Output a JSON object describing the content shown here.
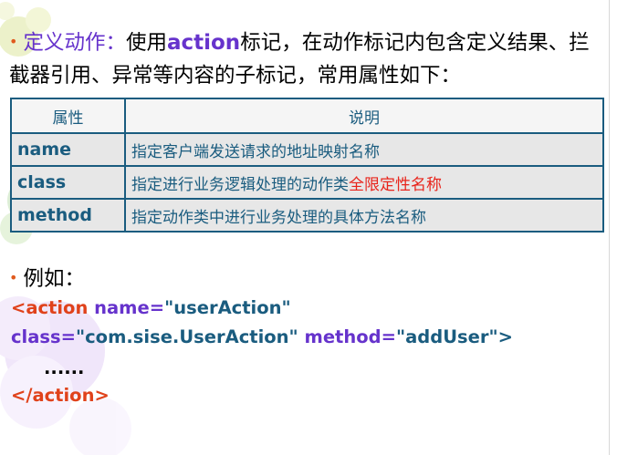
{
  "intro": {
    "bullet": "•",
    "label": "定义动作：",
    "text_before": "使用",
    "keyword": "action",
    "text_after": "标记，在动作标记内包含定义结果、拦截器引用、异常等内容的子标记，常用属性如下："
  },
  "table": {
    "headers": [
      "属性",
      "说明"
    ],
    "rows": [
      {
        "attr": "name",
        "desc": "指定客户端发送请求的地址映射名称",
        "desc_highlight": ""
      },
      {
        "attr": "class",
        "desc": "指定进行业务逻辑处理的动作类",
        "desc_highlight": "全限定性名称"
      },
      {
        "attr": "method",
        "desc": "指定动作类中进行业务处理的具体方法名称",
        "desc_highlight": ""
      }
    ]
  },
  "example": {
    "bullet": "•",
    "label": "例如："
  },
  "code": {
    "line1_tag": "<action",
    "line1_attr": "name=",
    "line1_value": "\"userAction\"",
    "line2_attr1": "class=",
    "line2_value1": "\"com.sise.UserAction\"",
    "line2_attr2": "method=",
    "line2_value2": "\"addUser\"",
    "line2_end": ">",
    "line3": "......",
    "line4": "</action>"
  },
  "colors": {
    "bullet": "#e05a1e",
    "label": "#6633cc",
    "table_border": "#1a5c7f",
    "code_tag": "#e0421b",
    "code_attr": "#6633cc",
    "code_value": "#1a5c7f"
  }
}
